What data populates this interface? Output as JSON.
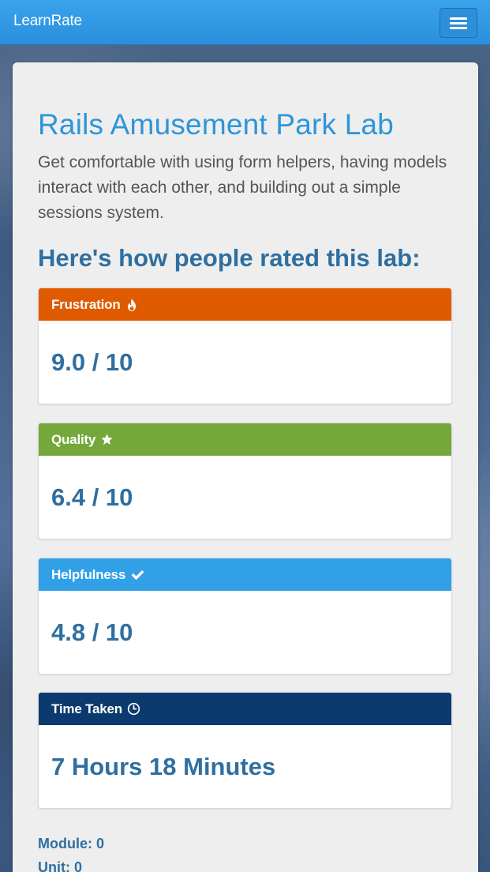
{
  "navbar": {
    "brand": "LearnRate",
    "menu_toggle": "menu-icon",
    "color": "#2f95e0"
  },
  "lab": {
    "title": "Rails Amusement Park Lab",
    "description": "Get comfortable with using form helpers, having models interact with each other, and building out a simple sessions system."
  },
  "ratings": {
    "heading": "Here's how people rated this lab:",
    "panels": [
      {
        "label": "Frustration",
        "icon": "fire-icon",
        "color": "#e05a00",
        "value": "9.0 / 10"
      },
      {
        "label": "Quality",
        "icon": "star-icon",
        "color": "#74a83a",
        "value": "6.4 / 10"
      },
      {
        "label": "Helpfulness",
        "icon": "check-icon",
        "color": "#31a0e6",
        "value": "4.8 / 10"
      },
      {
        "label": "Time Taken",
        "icon": "clock-icon",
        "color": "#0b3a6e",
        "value": "7 Hours 18 Minutes"
      }
    ]
  },
  "meta": {
    "module": "Module: 0",
    "unit": "Unit: 0"
  }
}
